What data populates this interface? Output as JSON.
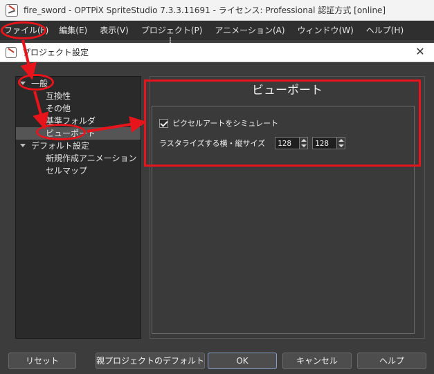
{
  "window": {
    "title": "fire_sword - OPTPiX SpriteStudio 7.3.3.11691 - ライセンス: Professional 認証方式 [online]"
  },
  "menu": {
    "items": [
      {
        "label": "ファイル(F)"
      },
      {
        "label": "編集(E)"
      },
      {
        "label": "表示(V)"
      },
      {
        "label": "プロジェクト(P)"
      },
      {
        "label": "アニメーション(A)"
      },
      {
        "label": "ウィンドウ(W)"
      },
      {
        "label": "ヘルプ(H)"
      }
    ]
  },
  "dialog": {
    "title": "プロジェクト設定",
    "close_glyph": "✕"
  },
  "tree": {
    "items": [
      {
        "label": "一般"
      },
      {
        "label": "互換性"
      },
      {
        "label": "その他"
      },
      {
        "label": "基準フォルダ"
      },
      {
        "label": "ビューポート"
      },
      {
        "label": "デフォルト設定"
      },
      {
        "label": "新規作成アニメーション"
      },
      {
        "label": "セルマップ"
      }
    ],
    "selected": "ビューポート"
  },
  "panel": {
    "header": "ビューポート",
    "simulate_pixel_art_label": "ピクセルアートをシミュレート",
    "simulate_pixel_art_checked": true,
    "rasterize_size_label": "ラスタライズする横・縦サイズ",
    "rasterize_width": "128",
    "rasterize_height": "128"
  },
  "buttons": {
    "reset": "リセット",
    "parent_default": "親プロジェクトのデフォルトにす",
    "ok": "OK",
    "cancel": "キャンセル",
    "help": "ヘルプ"
  },
  "colors": {
    "annotation": "#e8141b",
    "dark_bg": "#3c3c3c",
    "tree_bg": "#2a2a2a",
    "selection": "#555555"
  }
}
